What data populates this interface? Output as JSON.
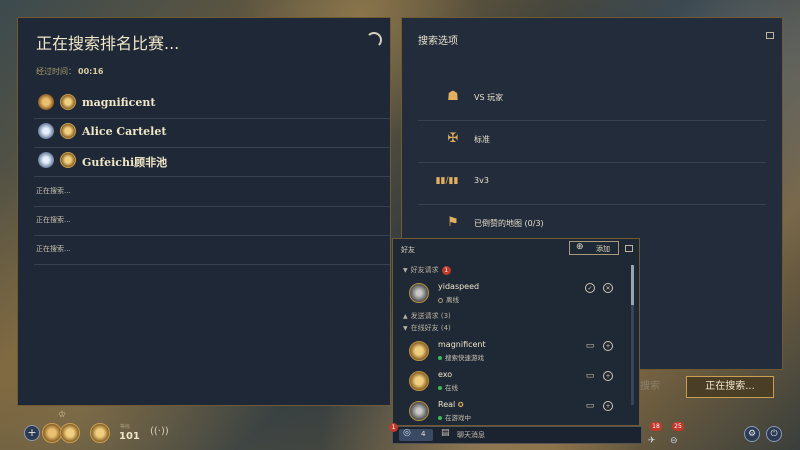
{
  "left_panel": {
    "title": "正在搜索排名比赛...",
    "elapsed_label": "经过时间：",
    "elapsed_value": "00:16",
    "players": [
      {
        "name": "magnificent"
      },
      {
        "name": "Alice Cartelet"
      },
      {
        "name": "Gufeichi顾非池"
      }
    ],
    "searching_slots": [
      "正在搜索...",
      "正在搜索...",
      "正在搜索..."
    ]
  },
  "right_panel": {
    "title": "搜索选项",
    "options": [
      {
        "label": "VS 玩家",
        "icon": "vs-players-icon"
      },
      {
        "label": "标准",
        "icon": "standard-mode-icon"
      },
      {
        "label": "3v3",
        "icon": "team-size-icon"
      },
      {
        "label": "已倒赞的地图 (0/3)",
        "icon": "map-icon"
      }
    ]
  },
  "friends": {
    "header": "好友",
    "add_label": "添加",
    "requests_label": "好友请求",
    "requests_count": "1",
    "request": {
      "name": "yidaspeed",
      "status": "离线"
    },
    "sent_label": "发送请求 (3)",
    "online_label": "在线好友 (4)",
    "online": [
      {
        "name": "magnificent",
        "status": "搜索快速游戏"
      },
      {
        "name": "exo",
        "status": "在线"
      },
      {
        "name": "Real",
        "status": "在游戏中"
      }
    ]
  },
  "actions": {
    "search_button": "正在搜索...",
    "cancel_ghost": "搜索"
  },
  "bottom_bar": {
    "level_label": "等级",
    "level_value": "101",
    "chat_count": "4",
    "chat_label": "聊天消息",
    "notif_count_1": "18",
    "notif_count_2": "25",
    "chat_badge": "1"
  }
}
